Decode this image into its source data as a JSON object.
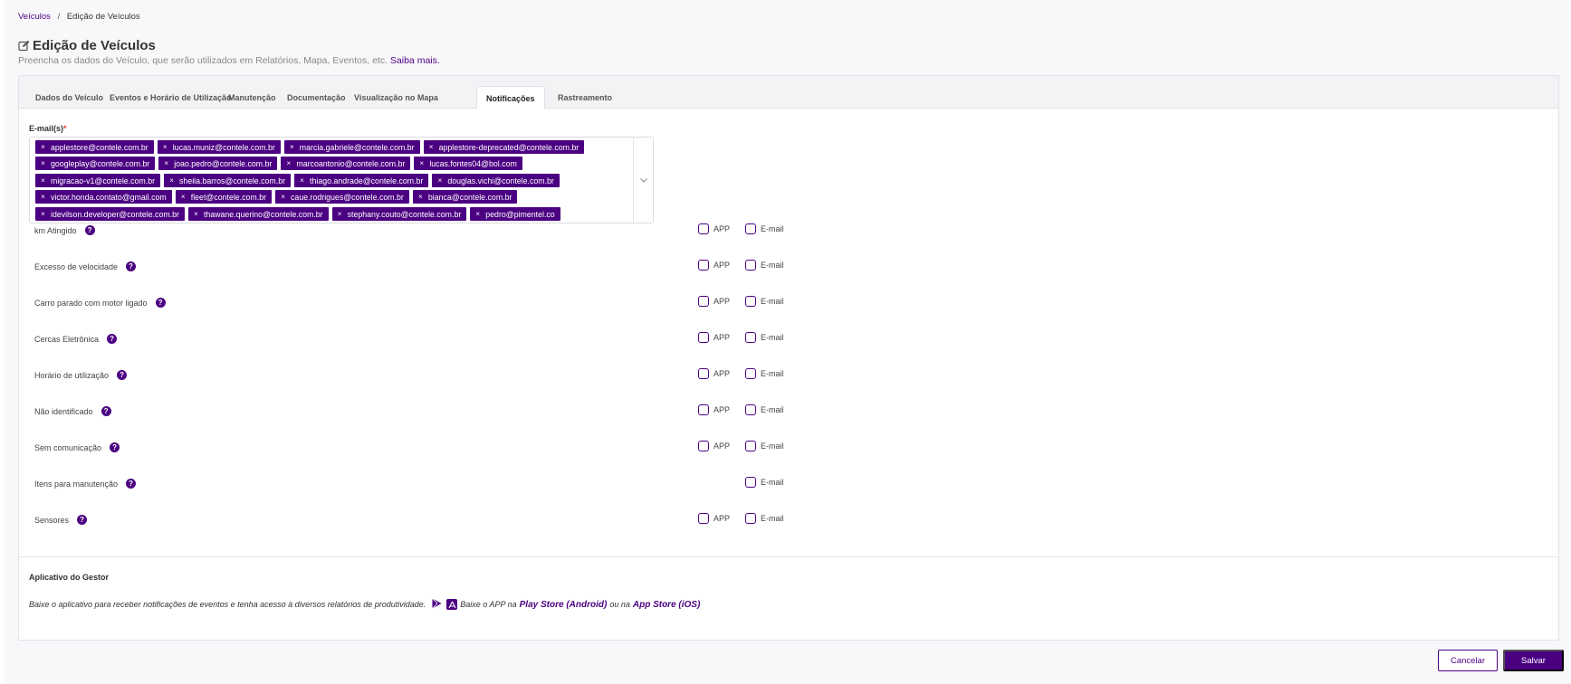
{
  "breadcrumb": {
    "parent": "Veículos",
    "current": "Edição de Veículos"
  },
  "header": {
    "title": "Edição de Veículos",
    "subtitle": "Preencha os dados do Veículo, que serão utilizados em Relatórios, Mapa, Eventos, etc.",
    "subtitle_link": "Saiba mais."
  },
  "tabs": [
    {
      "label": "Dados do Veículo"
    },
    {
      "label": "Eventos e Horário de Utilização"
    },
    {
      "label": "Manutenção"
    },
    {
      "label": "Documentação"
    },
    {
      "label": "Visualização no Mapa"
    },
    {
      "label": "Notificações",
      "active": true
    },
    {
      "label": "Rastreamento"
    }
  ],
  "emails": {
    "label": "E-mail(s)",
    "required_mark": "*",
    "remove_glyph": "×",
    "chips": [
      [
        "applestore@contele.com.br",
        "lucas.muniz@contele.com.br",
        "marcia.gabriele@contele.com.br",
        "applestore-deprecated@contele.com.br"
      ],
      [
        "googleplay@contele.com.br",
        "joao.pedro@contele.com.br",
        "marcoantonio@contele.com.br",
        "lucas.fontes04@bol.com"
      ],
      [
        "migracao-v1@contele.com.br",
        "sheila.barros@contele.com.br",
        "thiago.andrade@contele.com.br",
        "douglas.vichi@contele.com.br"
      ],
      [
        "victor.honda.contato@gmail.com",
        "fleet@contele.com.br",
        "caue.rodrigues@contele.com.br",
        "bianca@contele.com.br"
      ],
      [
        "idevilson.developer@contele.com.br",
        "thawane.querino@contele.com.br",
        "stephany.couto@contele.com.br",
        "pedro@pimentel.co"
      ]
    ]
  },
  "notifications": {
    "app_label": "APP",
    "email_label": "E-mail",
    "items": [
      {
        "label": "km Atingido",
        "app": true
      },
      {
        "label": "Excesso de velocidade",
        "app": true
      },
      {
        "label": "Carro parado com motor ligado",
        "app": true
      },
      {
        "label": "Cercas Eletrônica",
        "app": true
      },
      {
        "label": "Horário de utilização",
        "app": true
      },
      {
        "label": "Não identificado",
        "app": true
      },
      {
        "label": "Sem comunicação",
        "app": true
      },
      {
        "label": "Itens para manutenção",
        "app": false
      },
      {
        "label": "Sensores",
        "app": true
      }
    ]
  },
  "gestor_app": {
    "title": "Aplicativo do Gestor",
    "description": "Baixe o aplicativo para receber notificações de eventos e tenha acesso à diversos relatórios de produtividade.",
    "download_prefix": "Baixe o APP na",
    "play_store": "Play Store (Android)",
    "connector": "ou na",
    "app_store": "App Store (iOS)"
  },
  "footer": {
    "cancel_label": "Cancelar",
    "save_label": "Salvar"
  },
  "colors": {
    "accent": "#4b0082",
    "background": "#f8f8fa"
  },
  "icons": {
    "title": "edit-icon",
    "help": "question-circle-icon",
    "play_store": "google-play-icon",
    "app_store": "app-store-icon"
  }
}
